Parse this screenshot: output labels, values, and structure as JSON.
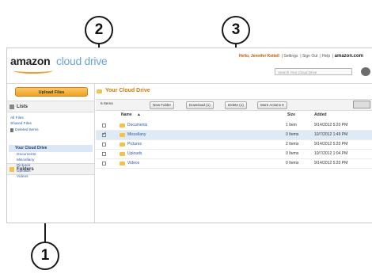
{
  "callouts": [
    "2",
    "3",
    "1"
  ],
  "header": {
    "logo_main": "amazon",
    "logo_sub": "cloud drive",
    "greeting": "Hello, Jennifer Kettell",
    "links": [
      "Settings",
      "Sign Out",
      "Help"
    ],
    "brand": "amazon.com",
    "search_placeholder": "Search Your Cloud Drive"
  },
  "sidebar": {
    "upload_label": "Upload Files",
    "lists_heading": "Lists",
    "lists": [
      "All Files",
      "Shared Files",
      "Deleted Items"
    ],
    "folders_heading": "Folders",
    "tree_root": "Your Cloud Drive",
    "tree_items": [
      "Documents",
      "Miscellany",
      "Pictures",
      "Uploads",
      "Videos"
    ]
  },
  "main": {
    "title": "Your Cloud Drive",
    "items_count": "5 Items",
    "toolbar": {
      "new_folder": "New Folder",
      "download": "Download (1)",
      "delete": "Delete (1)",
      "more_actions": "More Actions"
    },
    "columns": {
      "name": "Name",
      "size": "Size",
      "added": "Added"
    },
    "rows": [
      {
        "name": "Documents",
        "size": "1 Item",
        "added": "9/14/2012 5:20 PM",
        "checked": false
      },
      {
        "name": "Miscellany",
        "size": "0 Items",
        "added": "10/7/2012 1:49 PM",
        "checked": true
      },
      {
        "name": "Pictures",
        "size": "2 Items",
        "added": "9/14/2012 5:20 PM",
        "checked": false
      },
      {
        "name": "Uploads",
        "size": "0 Items",
        "added": "10/7/2012 1:04 PM",
        "checked": false
      },
      {
        "name": "Videos",
        "size": "0 Items",
        "added": "9/14/2012 5:20 PM",
        "checked": false
      }
    ]
  },
  "colors": {
    "accent": "#f0a21b",
    "link": "#2a5db0",
    "selected_row": "#dfeaf7",
    "title": "#d07a00"
  }
}
